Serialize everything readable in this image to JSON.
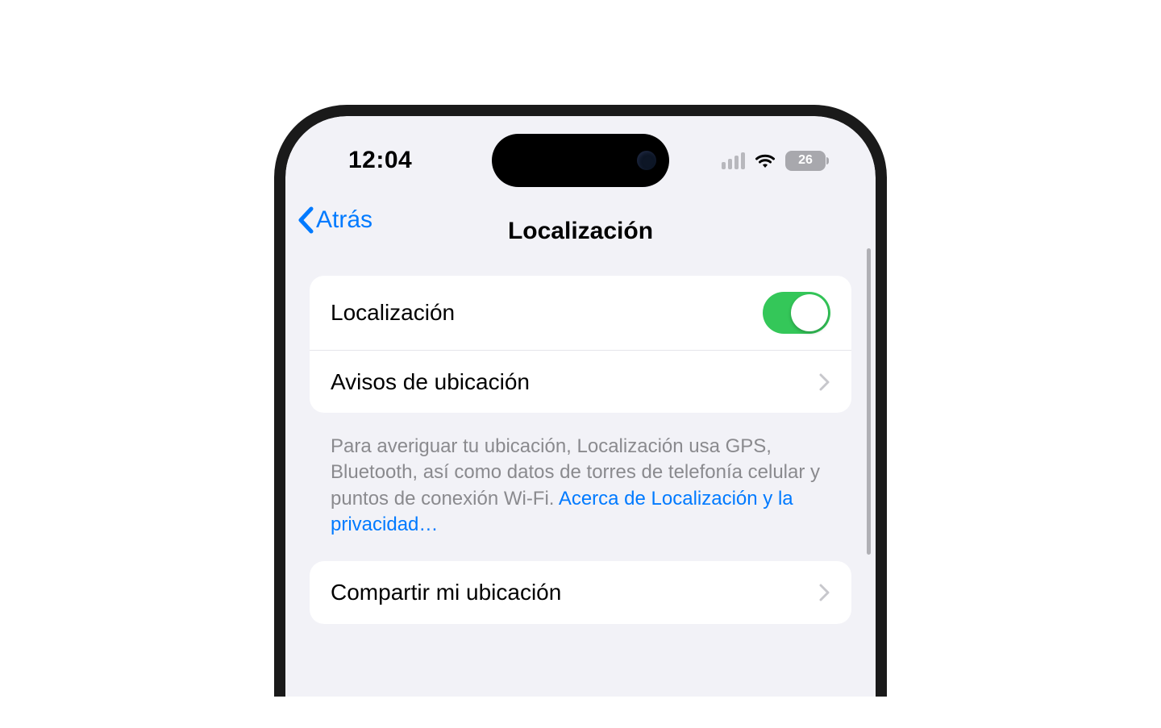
{
  "status": {
    "time": "12:04",
    "battery": "26"
  },
  "nav": {
    "back_label": "Atrás",
    "title": "Localización"
  },
  "group1": {
    "row0_label": "Localización",
    "row0_toggle_on": true,
    "row1_label": "Avisos de ubicación"
  },
  "footer": {
    "text": "Para averiguar tu ubicación, Localización usa GPS, Bluetooth, así como datos de torres de telefonía celular y puntos de conexión Wi-Fi. ",
    "link": "Acerca de Localización y la privacidad…"
  },
  "group2": {
    "row0_label": "Compartir mi ubicación"
  },
  "colors": {
    "accent": "#007aff",
    "toggle_on": "#34c759",
    "bg": "#f2f2f7"
  }
}
